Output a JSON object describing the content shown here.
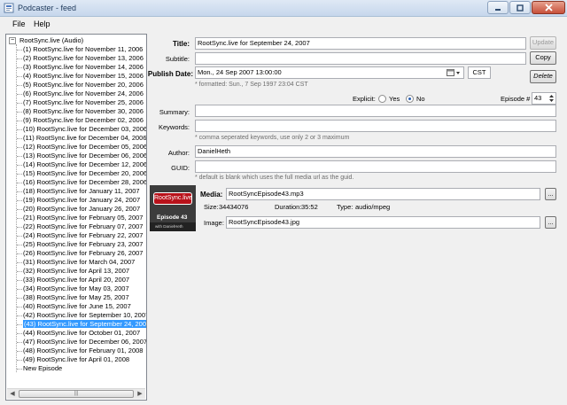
{
  "window": {
    "title": "Podcaster - feed"
  },
  "menu": [
    "File",
    "Help"
  ],
  "tree": {
    "root": "RootSync.live (Audio)",
    "items": [
      "(1) RootSync.live for November 11, 2006",
      "(2) RootSync.live for November 13, 2006",
      "(3) RootSync.live for November 14, 2006",
      "(4) RootSync.live for November 15, 2006",
      "(5) RootSync.live for November 20, 2006",
      "(6) RootSync.live for November 24, 2006",
      "(7) RootSync.live for November 25, 2006",
      "(8) RootSync.live for November 30, 2006",
      "(9) RootSync.live for December 02, 2006",
      "(10) RootSync.live for December 03, 2006",
      "(11) RootSync.live for December 04, 2006",
      "(12) RootSync.live for December 05, 2006",
      "(13) RootSync.live for December 06, 2006",
      "(14) RootSync.live for December 12, 2006",
      "(15) RootSync.live for December 20, 2006",
      "(16) RootSync.live for December 28, 2006",
      "(18) RootSync.live for January 11, 2007",
      "(19) RootSync.live for January 24, 2007",
      "(20) RootSync.live for January 26, 2007",
      "(21) RootSync.live for February 05, 2007",
      "(22) RootSync.live for February 07, 2007",
      "(24) RootSync.live for February 22, 2007",
      "(25) RootSync.live for February 23, 2007",
      "(26) RootSync.live for February 26, 2007",
      "(31) RootSync.live for March 04, 2007",
      "(32) RootSync.live for April 13, 2007",
      "(33) RootSync.live for April 20, 2007",
      "(34) RootSync.live for May 03, 2007",
      "(38) RootSync.live for May 25, 2007",
      "(40) RootSync.live for June 15, 2007",
      "(42) RootSync.live for September 10, 2007",
      "(43) RootSync.live for September 24, 2007",
      "(44) RootSync.live for October 01, 2007",
      "(47) RootSync.live for December 06, 2007",
      "(48) RootSync.live for February 01, 2008",
      "(49) RootSync.live for April 01, 2008",
      "New Episode"
    ],
    "selected_index": 31
  },
  "form": {
    "title_label": "Title:",
    "title_value": "RootSync.live for September 24, 2007",
    "update_button": "Update",
    "subtitle_label": "Subtitle:",
    "subtitle_value": "",
    "copy_button": "Copy",
    "pubdate_label": "Publish Date:",
    "pubdate_value": "Mon., 24 Sep 2007 13:00:00",
    "timezone_value": "CST",
    "delete_button": "Delete",
    "formatted_hint": "* formatted:  Sun., 7 Sep 1997 23:04 CST",
    "explicit_label": "Explicit:",
    "explicit_yes": "Yes",
    "explicit_no": "No",
    "explicit_selected": "No",
    "episode_label": "Episode #",
    "episode_value": "43",
    "summary_label": "Summary:",
    "summary_value": "",
    "keywords_label": "Keywords:",
    "keywords_value": "",
    "keywords_hint": "* comma seperated keywords, use only 2 or 3 maximum",
    "author_label": "Author:",
    "author_value": "DanielHeth",
    "guid_label": "GUID:",
    "guid_value": "",
    "guid_hint": "* default is blank which uses the full media url as the guid.",
    "media_label": "Media:",
    "media_value": "RootSyncEpisode43.mp3",
    "browse_label": "...",
    "size_label": "Size:",
    "size_value": "34434076",
    "duration_label": "Duration:",
    "duration_value": "35:52",
    "type_label": "Type:",
    "type_value": "audio/mpeg",
    "image_label": "Image:",
    "image_value": "RootSyncEpisode43.jpg"
  },
  "thumbnail": {
    "badge": "RootSync.live",
    "episode": "Episode 43",
    "caption": "with DanielHeth"
  },
  "colors": {
    "selection": "#3399ff",
    "hint": "#6d6d6d",
    "badge": "#b8111a"
  }
}
